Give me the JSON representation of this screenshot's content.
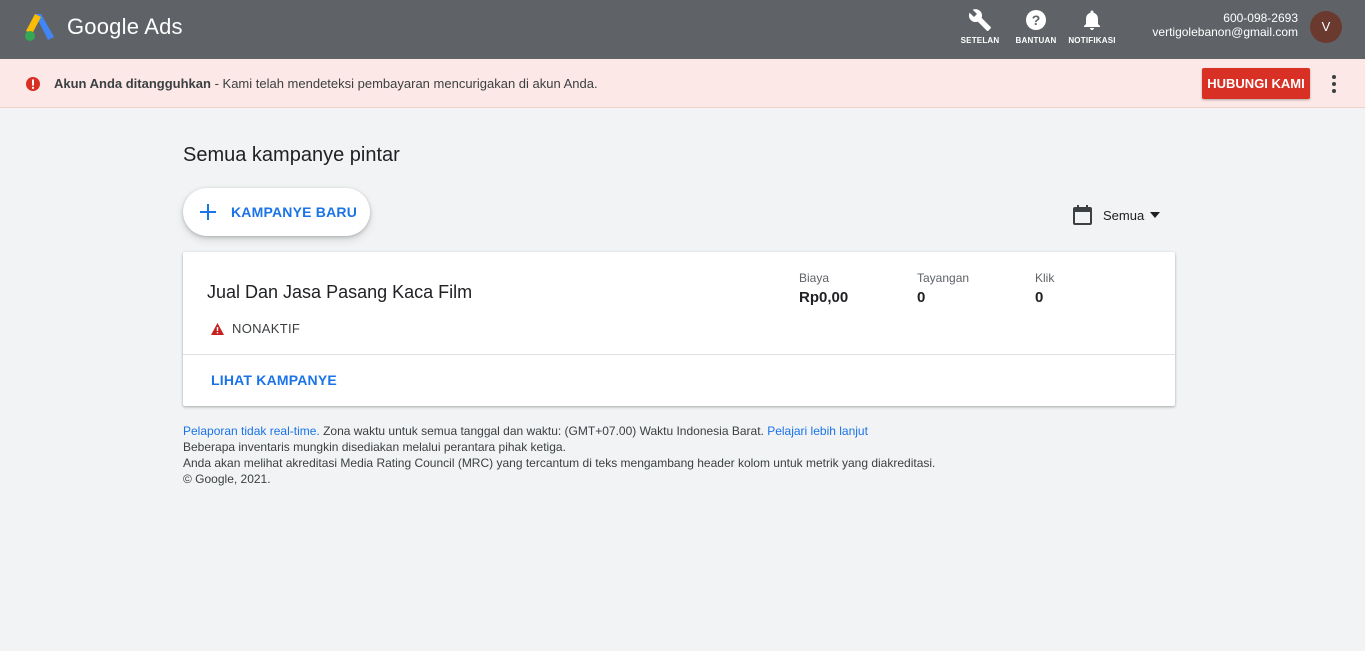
{
  "header": {
    "brand": "Google Ads",
    "tools": [
      {
        "label": "SETELAN",
        "icon": "wrench-icon"
      },
      {
        "label": "BANTUAN",
        "icon": "help-icon"
      },
      {
        "label": "NOTIFIKASI",
        "icon": "bell-icon"
      }
    ],
    "account_id": "600-098-2693",
    "account_email": "vertigolebanon@gmail.com",
    "avatar_initial": "V"
  },
  "alert": {
    "title": "Akun Anda ditangguhkan",
    "message": " - Kami telah mendeteksi pembayaran mencurigakan di akun Anda.",
    "contact_button": "HUBUNGI KAMI",
    "icon": "error-icon"
  },
  "main": {
    "title": "Semua kampanye pintar",
    "new_campaign_label": "KAMPANYE BARU",
    "date_filter": "Semua"
  },
  "campaign": {
    "name": "Jual Dan Jasa Pasang Kaca Film",
    "status": "NONAKTIF",
    "metrics": [
      {
        "label": "Biaya",
        "value": "Rp0,00"
      },
      {
        "label": "Tayangan",
        "value": "0"
      },
      {
        "label": "Klik",
        "value": "0"
      }
    ],
    "view_link": "LIHAT KAMPANYE"
  },
  "footer": {
    "line1_link": "Pelaporan tidak real-time.",
    "line1_text": " Zona waktu untuk semua tanggal dan waktu: (GMT+07.00) Waktu Indonesia Barat. ",
    "line1_link2": "Pelajari lebih lanjut",
    "line2": "Beberapa inventaris mungkin disediakan melalui perantara pihak ketiga.",
    "line3": "Anda akan melihat akreditasi Media Rating Council (MRC) yang tercantum di teks mengambang header kolom untuk metrik yang diakreditasi.",
    "line4": "© Google, 2021."
  },
  "colors": {
    "topbar": "#5f6368",
    "alert_bg": "#fce8e6",
    "alert_red": "#d93025",
    "link_blue": "#1a73e8",
    "page_bg": "#f1f3f4"
  }
}
